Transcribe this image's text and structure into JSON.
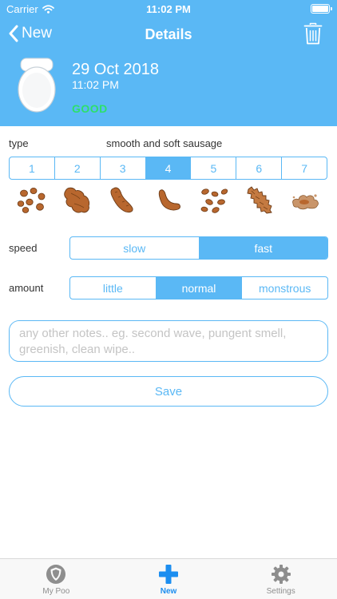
{
  "status_bar": {
    "carrier": "Carrier",
    "time": "11:02 PM"
  },
  "nav": {
    "back_label": "New",
    "title": "Details"
  },
  "record": {
    "date": "29 Oct 2018",
    "time": "11:02 PM",
    "badge": "GOOD"
  },
  "type_section": {
    "label": "type",
    "description": "smooth and soft sausage",
    "options": [
      "1",
      "2",
      "3",
      "4",
      "5",
      "6",
      "7"
    ],
    "selected_index": 3
  },
  "speed": {
    "label": "speed",
    "options": [
      "slow",
      "fast"
    ],
    "selected_index": 1
  },
  "amount": {
    "label": "amount",
    "options": [
      "little",
      "normal",
      "monstrous"
    ],
    "selected_index": 1
  },
  "notes": {
    "placeholder": "any other notes.. eg. second wave, pungent smell, greenish, clean wipe..",
    "value": ""
  },
  "save_label": "Save",
  "tabs": [
    {
      "label": "My Poo",
      "icon": "shield-icon",
      "active": false
    },
    {
      "label": "New",
      "icon": "plus-icon",
      "active": true
    },
    {
      "label": "Settings",
      "icon": "gear-icon",
      "active": false
    }
  ],
  "colors": {
    "accent": "#5ab8f5",
    "header_bg": "#5ab8f5",
    "badge_good": "#2de06a",
    "tab_active": "#1c8ef0",
    "poo_brown": "#b8672e"
  }
}
